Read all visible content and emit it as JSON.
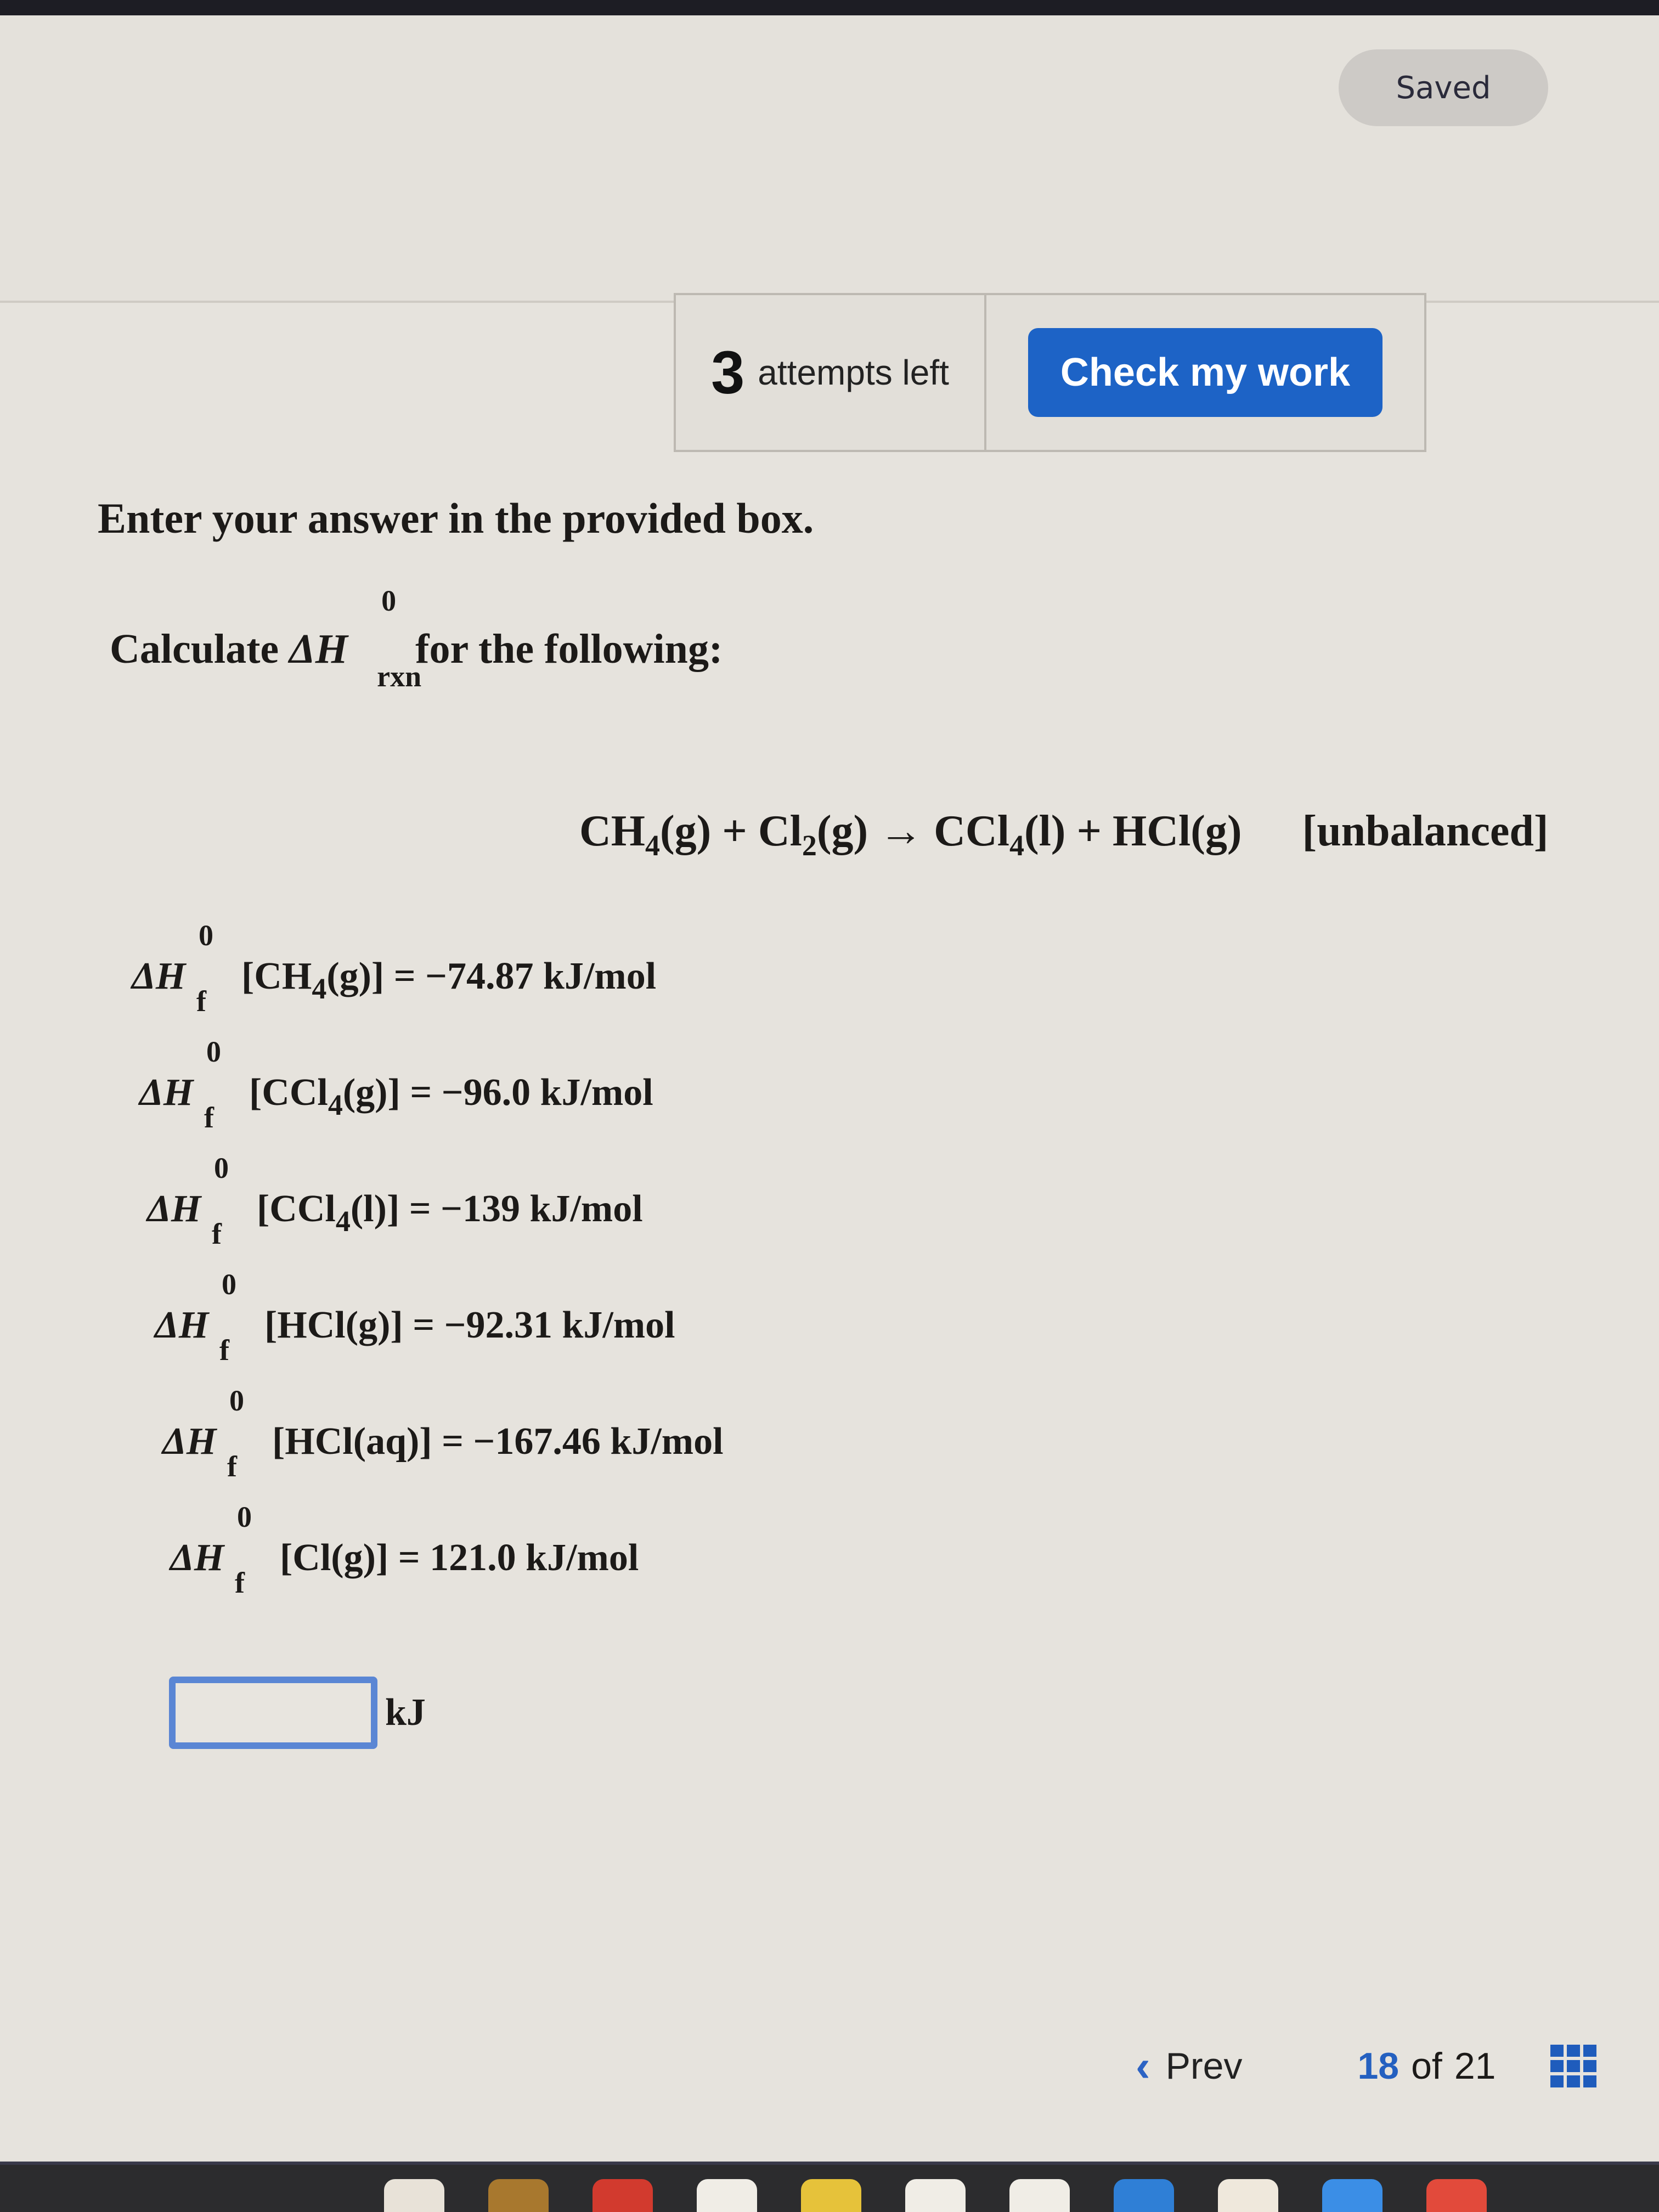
{
  "header": {
    "saved_status": "Saved"
  },
  "attempts": {
    "count": "3",
    "label": "attempts left",
    "check_button": "Check my work"
  },
  "question": {
    "instruction": "Enter your answer in the provided box.",
    "calc_prefix": "Calculate",
    "delta_h": "ΔH",
    "calc_sup": "0",
    "calc_sub": "rxn",
    "calc_suffix": "for the following:",
    "equation": {
      "parts": [
        "CH",
        "4",
        "(g) + Cl",
        "2",
        "(g) → CCl",
        "4",
        "(l) + HCl(g)"
      ],
      "note": "[unbalanced]"
    },
    "formation_data": [
      {
        "sup": "0",
        "sub": "f",
        "species_pre": "[CH",
        "species_sub": "4",
        "species_post": "(g)]",
        "value": "= −74.87 kJ/mol"
      },
      {
        "sup": "0",
        "sub": "f",
        "species_pre": "[CCl",
        "species_sub": "4",
        "species_post": "(g)]",
        "value": "= −96.0 kJ/mol"
      },
      {
        "sup": "0",
        "sub": "f",
        "species_pre": "[CCl",
        "species_sub": "4",
        "species_post": "(l)]",
        "value": "= −139 kJ/mol"
      },
      {
        "sup": "0",
        "sub": "f",
        "species_pre": "[HCl(g)]",
        "species_sub": "",
        "species_post": "",
        "value": "= −92.31 kJ/mol"
      },
      {
        "sup": "0",
        "sub": "f",
        "species_pre": "[HCl(aq)]",
        "species_sub": "",
        "species_post": "",
        "value": "= −167.46 kJ/mol"
      },
      {
        "sup": "0",
        "sub": "f",
        "species_pre": "[Cl(g)]",
        "species_sub": "",
        "species_post": "",
        "value": "= 121.0 kJ/mol"
      }
    ],
    "answer": {
      "value": "",
      "placeholder": "",
      "unit": "kJ"
    }
  },
  "navigation": {
    "prev_label": "Prev",
    "current_page": "18",
    "of_label": "of",
    "total_pages": "21"
  },
  "colors": {
    "accent_blue": "#1d63c6",
    "input_border": "#5a86d4",
    "saved_pill": "#cdcac6"
  }
}
